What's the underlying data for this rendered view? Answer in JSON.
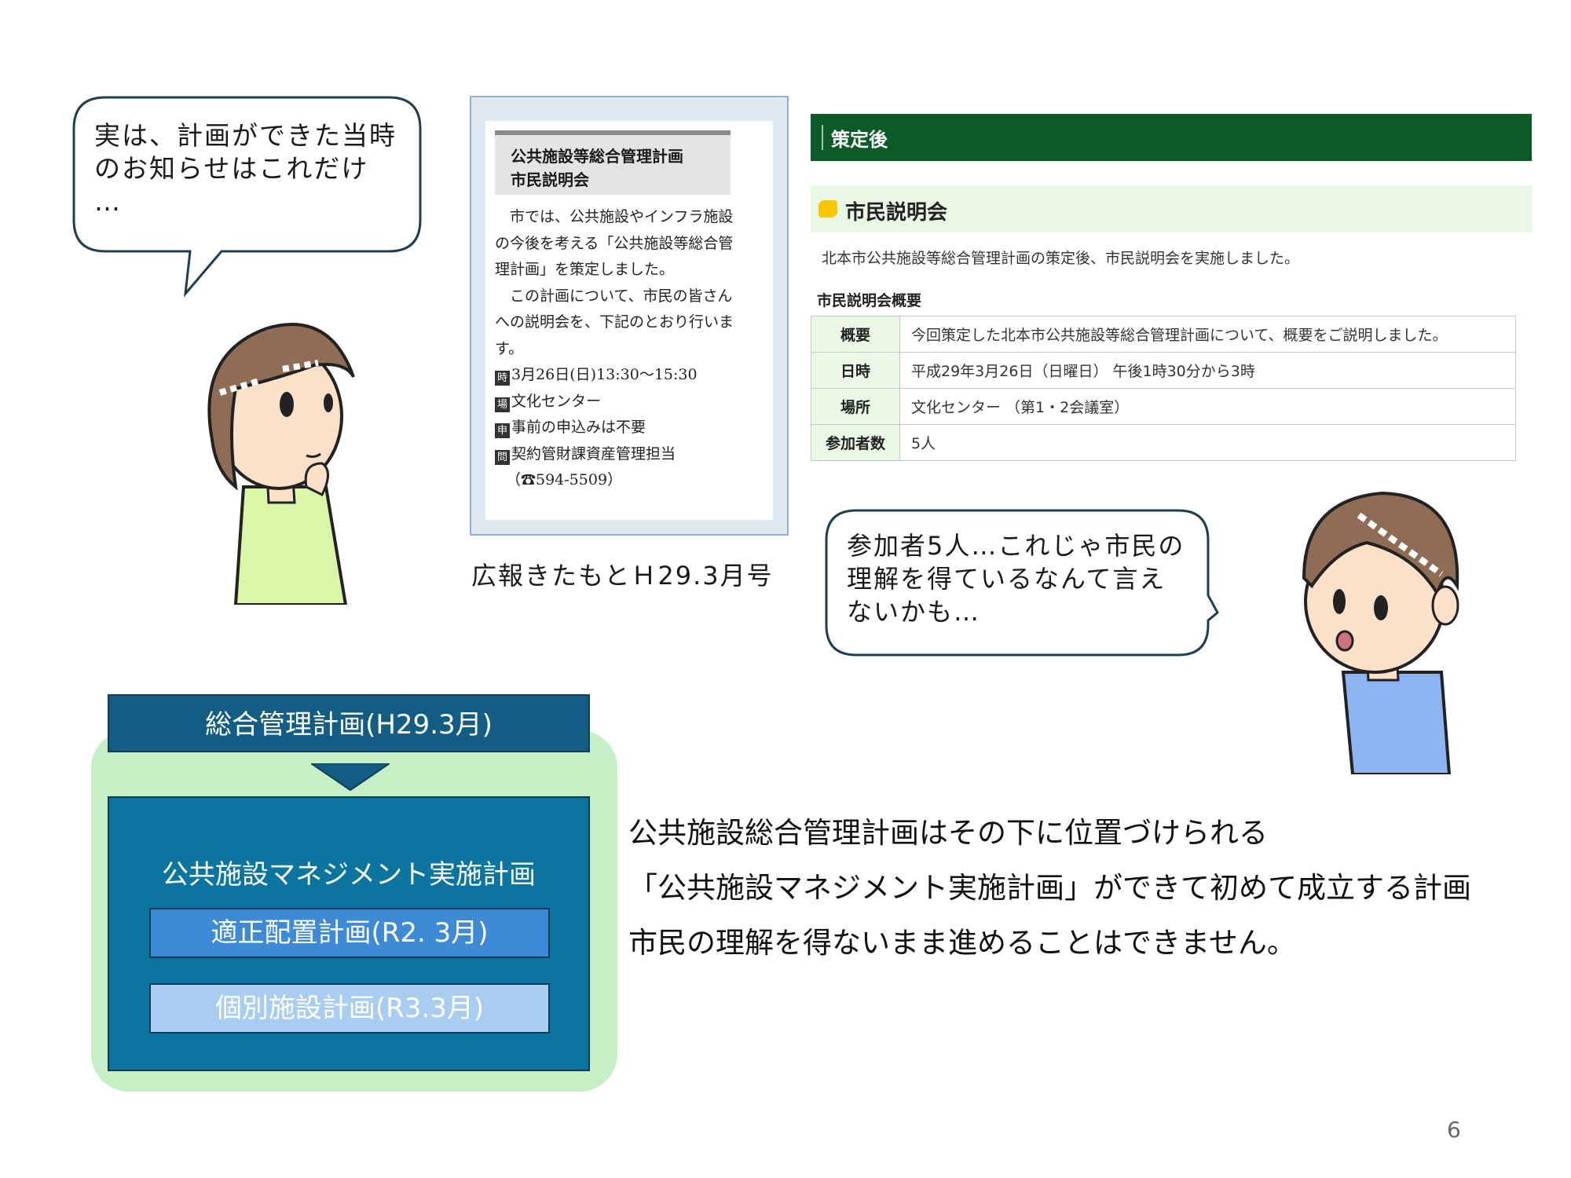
{
  "bubble_left": {
    "text": "実は、計画ができた当時\nのお知らせはこれだけ\n…"
  },
  "newsletter": {
    "heading_line1": "公共施設等総合管理計画",
    "heading_line2": "市民説明会",
    "para1": "市では、公共施設やインフラ施設の今後を考える「公共施設等総合管理計画」を策定しました。",
    "para2": "この計画について、市民の皆さんへの説明会を、下記のとおり行います。",
    "items": [
      {
        "tag": "時",
        "text": "3月26日(日)13:30～15:30"
      },
      {
        "tag": "場",
        "text": "文化センター"
      },
      {
        "tag": "申",
        "text": "事前の申込みは不要"
      },
      {
        "tag": "問",
        "text": "契約管財課資産管理担当"
      }
    ],
    "phone": "（☎594-5509）",
    "caption": "広報きたもとＨ29.3月号"
  },
  "web_panel": {
    "header": "策定後",
    "section_title": "市民説明会",
    "description": "北本市公共施設等総合管理計画の策定後、市民説明会を実施しました。",
    "summary_title": "市民説明会概要",
    "rows": [
      {
        "key": "概要",
        "value": "今回策定した北本市公共施設等総合管理計画について、概要をご説明しました。"
      },
      {
        "key": "日時",
        "value": "平成29年3月26日（日曜日） 午後1時30分から3時"
      },
      {
        "key": "場所",
        "value": "文化センター （第1・2会議室）"
      },
      {
        "key": "参加者数",
        "value": "5人"
      }
    ]
  },
  "bubble_right": {
    "text": "参加者5人…これじゃ市民の\n理解を得ているなんて言え\nないかも…"
  },
  "diagram": {
    "top": "総合管理計画(H29.3月)",
    "main": "公共施設マネジメント実施計画",
    "sub1": "適正配置計画(R2. 3月)",
    "sub2": "個別施設計画(R3.3月)"
  },
  "body_lines": [
    "公共施設総合管理計画はその下に位置づけられる",
    "「公共施設マネジメント実施計画」ができて初めて成立する計画",
    "市民の理解を得ないまま進めることはできません。"
  ],
  "page_number": "6"
}
